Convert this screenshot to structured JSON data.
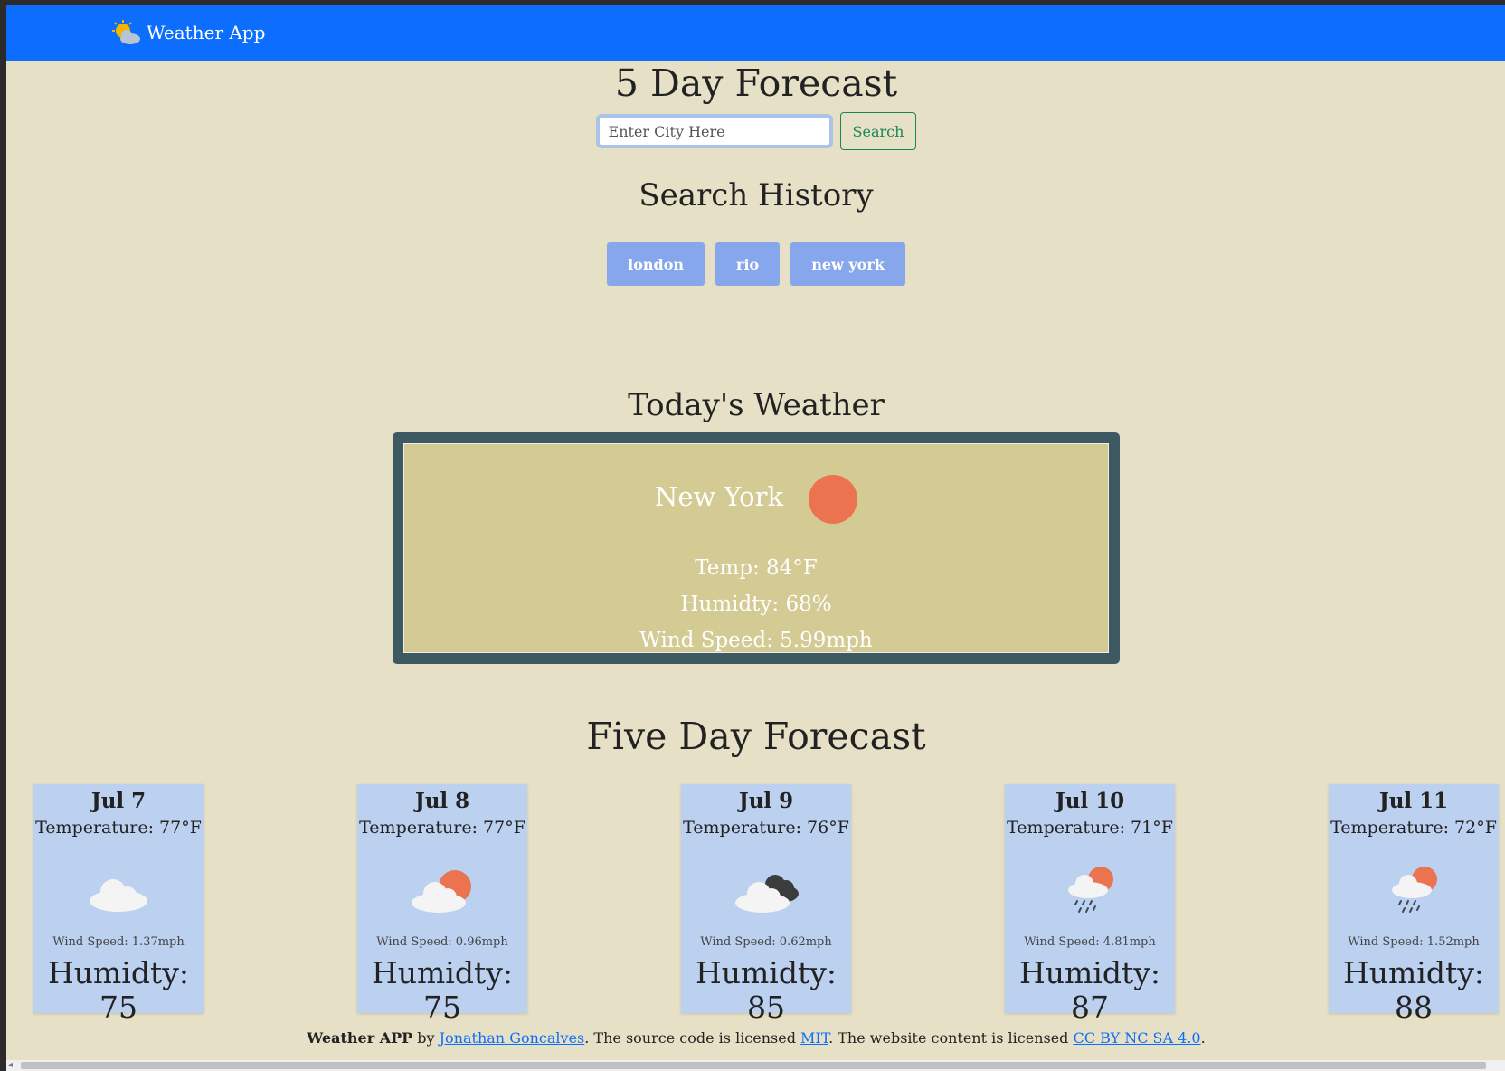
{
  "navbar": {
    "brand": "Weather App",
    "brand_icon": "partly-cloudy-icon"
  },
  "page_title": "5 Day Forecast",
  "search": {
    "placeholder": "Enter City Here",
    "value": "",
    "button_label": "Search"
  },
  "history": {
    "title": "Search History",
    "items": [
      "london",
      "rio",
      "new york"
    ]
  },
  "today": {
    "title": "Today's Weather",
    "city": "New York",
    "icon": "sun-icon",
    "temp": "Temp: 84°F",
    "humidity": "Humidty: 68%",
    "wind": "Wind Speed: 5.99mph"
  },
  "forecast": {
    "title": "Five Day Forecast",
    "days": [
      {
        "date": "Jul 7",
        "temp": "Temperature: 77°F",
        "icon": "cloud-icon",
        "wind": "Wind Speed: 1.37mph",
        "humidity": "Humidty: 75"
      },
      {
        "date": "Jul 8",
        "temp": "Temperature: 77°F",
        "icon": "partly-sunny-icon",
        "wind": "Wind Speed: 0.96mph",
        "humidity": "Humidty: 75"
      },
      {
        "date": "Jul 9",
        "temp": "Temperature: 76°F",
        "icon": "broken-clouds-icon",
        "wind": "Wind Speed: 0.62mph",
        "humidity": "Humidty: 85"
      },
      {
        "date": "Jul 10",
        "temp": "Temperature: 71°F",
        "icon": "sun-rain-icon",
        "wind": "Wind Speed: 4.81mph",
        "humidity": "Humidty: 87"
      },
      {
        "date": "Jul 11",
        "temp": "Temperature: 72°F",
        "icon": "sun-rain-icon",
        "wind": "Wind Speed: 1.52mph",
        "humidity": "Humidty: 88"
      }
    ]
  },
  "footer": {
    "app_name": "Weather APP",
    "by": " by ",
    "author": "Jonathan Goncalves",
    "mid1": ". The source code is licensed ",
    "code_license": "MIT",
    "mid2": ". The website content is licensed ",
    "content_license": "CC BY NC SA 4.0",
    "end": "."
  },
  "colors": {
    "navbar": "#0d6efd",
    "background": "#e6e0c6",
    "history_button": "#87a7ec",
    "today_border": "#3d5a63",
    "today_fill": "#d4cb94",
    "forecast_card": "#bcd0f0",
    "sun": "#ec7350"
  }
}
